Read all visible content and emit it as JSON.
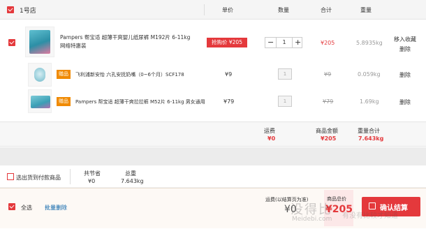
{
  "header": {
    "store": "1号店",
    "col_price": "单价",
    "col_qty": "数量",
    "col_subtotal": "合计",
    "col_weight": "重量"
  },
  "main_item": {
    "title": "Pampers 帮宝适 超薄干爽婴儿纸尿裤 M192片 6-11kg 网络特惠装",
    "promo": "抢购价 ¥205",
    "qty": "1",
    "minus": "−",
    "plus": "+",
    "subtotal": "¥205",
    "weight": "5.8935kg",
    "fav": "移入收藏",
    "delete": "删除"
  },
  "gifts": [
    {
      "tag": "赠品",
      "title": "飞利浦新安怡 六孔安抚奶嘴（0~6个月）SCF178",
      "price": "¥9",
      "qty": "1",
      "subtotal": "¥9",
      "weight": "0.059kg",
      "delete": "删除"
    },
    {
      "tag": "赠品",
      "title": "Pampers 帮宝适 超薄干爽拉拉裤 M52片 6-11kg 男女通用",
      "price": "¥79",
      "qty": "1",
      "subtotal": "¥79",
      "weight": "1.69kg",
      "delete": "删除"
    }
  ],
  "store_summary": {
    "freight_label": "运费",
    "freight": "¥0",
    "amount_label": "商品金额",
    "amount": "¥205",
    "weight_label": "重量合计",
    "weight": "7.643kg"
  },
  "info_bar": {
    "select_label": "选出货到付款商品",
    "saved_label": "共节省",
    "saved": "¥0",
    "weight_label": "总重",
    "weight": "7.643kg"
  },
  "footer": {
    "select_all": "全选",
    "batch_delete": "批量删除",
    "freight_label": "运费(以结算页为准)",
    "freight": "¥0",
    "total_label": "商品总价",
    "total": "¥205",
    "checkout": "确认结算"
  },
  "watermark": {
    "main": "没得比",
    "sub": "Meidebi.com",
    "slogan": "有没有比较才知道"
  },
  "colors": {
    "accent": "#e4393c",
    "gift": "#f08a00",
    "footer_bg": "#fdf9f5"
  }
}
